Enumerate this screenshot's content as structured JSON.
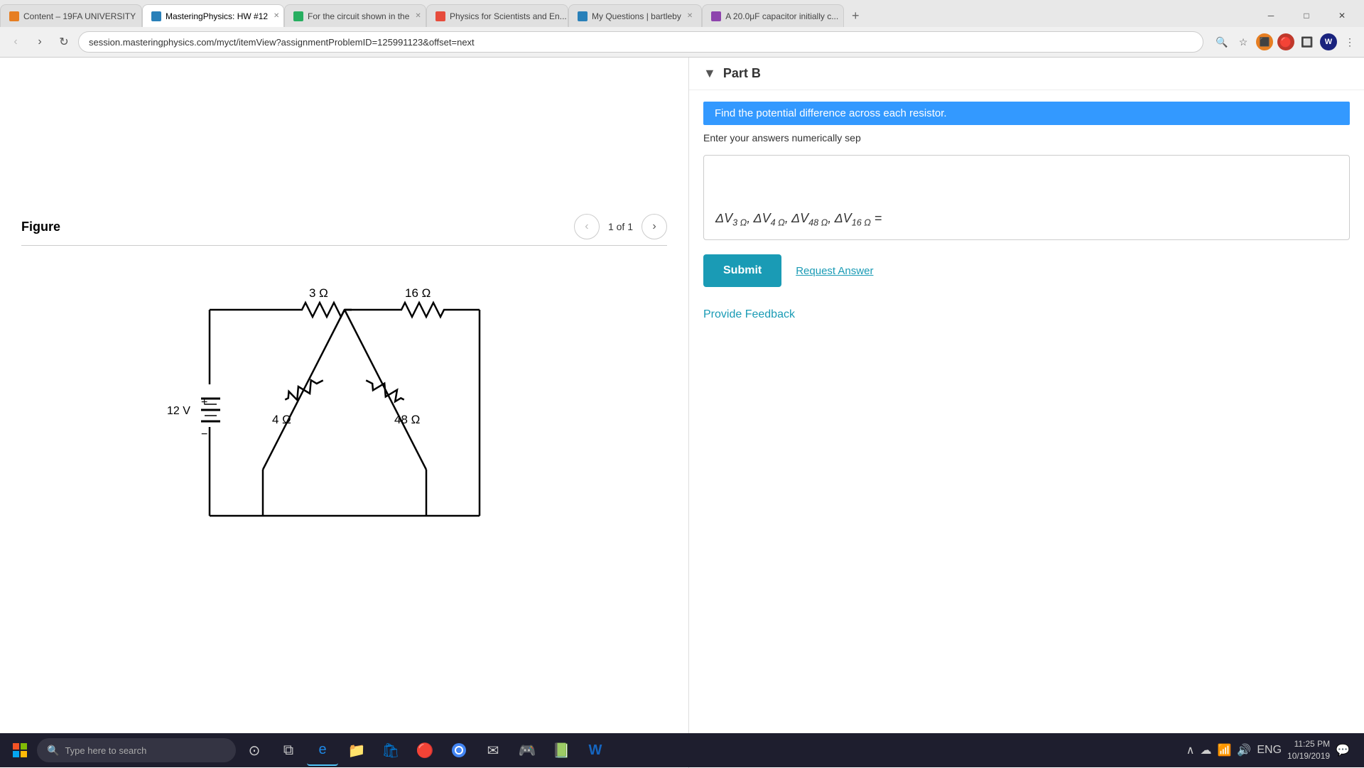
{
  "browser": {
    "tabs": [
      {
        "id": "t1",
        "favicon_color": "#e67e22",
        "label": "Content – 19FA UNIVERSITY",
        "active": false
      },
      {
        "id": "t2",
        "favicon_color": "#2980b9",
        "label": "MasteringPhysics: HW #12",
        "active": true
      },
      {
        "id": "t3",
        "favicon_color": "#27ae60",
        "label": "For the circuit shown in the",
        "active": false
      },
      {
        "id": "t4",
        "favicon_color": "#e74c3c",
        "label": "Physics for Scientists and En...",
        "active": false
      },
      {
        "id": "t5",
        "favicon_color": "#2980b9",
        "label": "My Questions | bartleby",
        "active": false
      },
      {
        "id": "t6",
        "favicon_color": "#8e44ad",
        "label": "A 20.0μF capacitor initially c...",
        "active": false
      }
    ],
    "address": "session.masteringphysics.com/myct/itemView?assignmentProblemID=125991123&offset=next",
    "new_tab_label": "+",
    "nav": {
      "back_disabled": false,
      "forward_disabled": false,
      "refresh_label": "↻"
    }
  },
  "left_panel": {
    "figure_title": "Figure",
    "page_info": "1 of 1",
    "nav_prev_label": "‹",
    "nav_next_label": "›",
    "circuit": {
      "voltage": "12 V",
      "resistors": [
        {
          "label": "3 Ω",
          "position": "top-left"
        },
        {
          "label": "16 Ω",
          "position": "top-right"
        },
        {
          "label": "4 Ω",
          "position": "middle-left"
        },
        {
          "label": "48 Ω",
          "position": "middle-right"
        }
      ],
      "plus_label": "+",
      "minus_label": "−"
    }
  },
  "right_panel": {
    "part_b_label": "Part B",
    "question_text": "Find the potential difference across each resistor.",
    "instructions": "Enter your answers numerically sep",
    "answer_formula": "ΔV₃Ω, ΔV₄Ω, ΔV₄₈Ω, ΔV₁₆Ω =",
    "submit_label": "Submit",
    "request_answer_label": "Request Answer",
    "provide_feedback_label": "Provide Feedback"
  },
  "taskbar": {
    "search_placeholder": "Type here to search",
    "apps": [
      "⊞",
      "⊙",
      "e",
      "📁",
      "🛍",
      "🔴",
      "G",
      "✉",
      "🎮",
      "📗",
      "W"
    ],
    "time": "11:25 PM",
    "date": "10/19/2019",
    "system_icons": [
      "∧",
      "☁",
      "📶",
      "🔊",
      "ENG"
    ]
  }
}
